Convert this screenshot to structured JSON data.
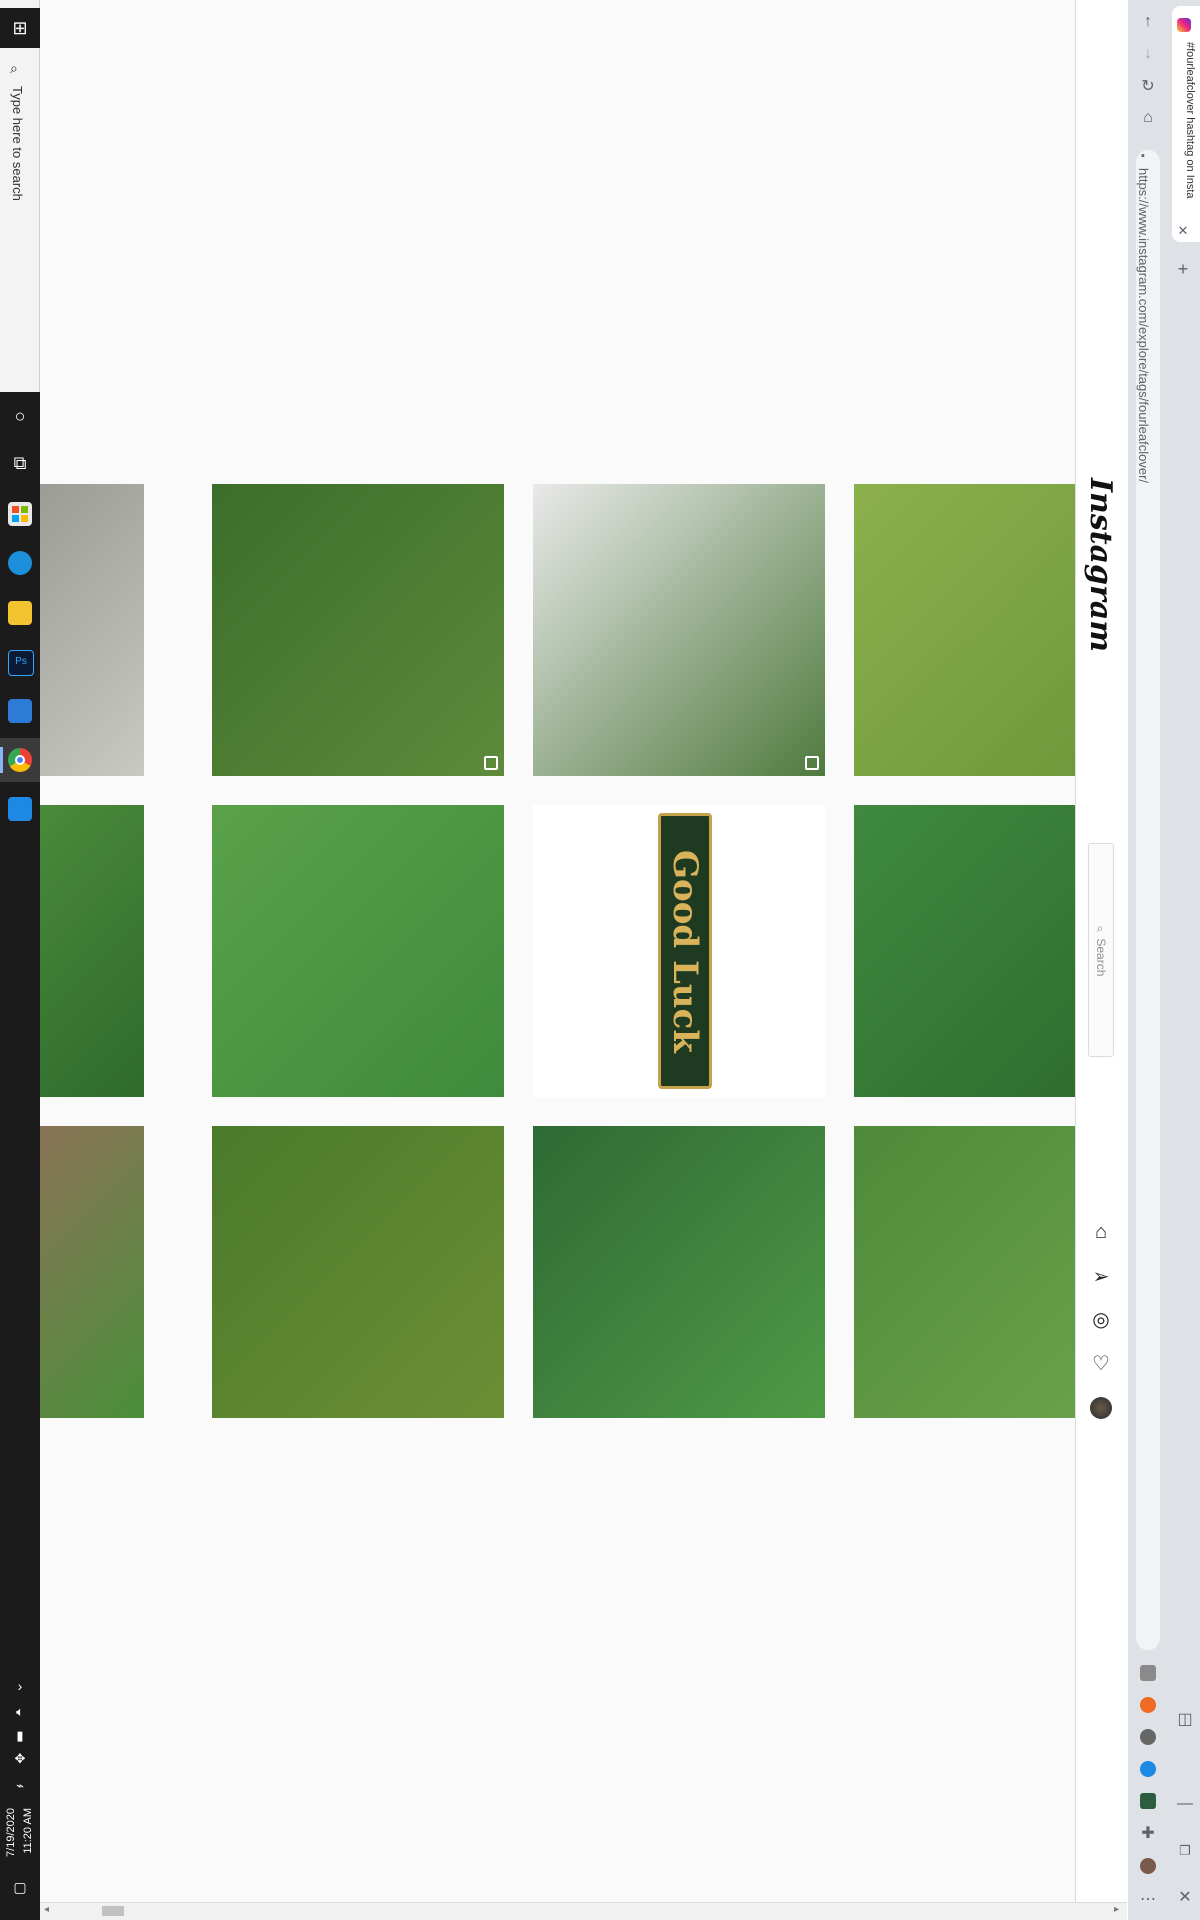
{
  "taskbar": {
    "search_placeholder": "Type here to search",
    "time": "11:20 AM",
    "date": "7/19/2020"
  },
  "browser": {
    "tab_title": "#fourleafclover hashtag on Insta",
    "url": "https://www.instagram.com/explore/tags/fourleafclover/"
  },
  "instagram": {
    "logo": "Instagram",
    "search_placeholder": "Search"
  },
  "grid": {
    "tiles": [
      {
        "name": "post-wood-fence",
        "colors": [
          "#9c9c97",
          "#c9c8c2"
        ]
      },
      {
        "name": "post-clover-dog",
        "colors": [
          "#3c6e2a",
          "#5e8a3b"
        ],
        "multi": true
      },
      {
        "name": "post-clover-mask-selfie",
        "colors": [
          "#e9e9e9",
          "#4f7a3e"
        ],
        "multi": true
      },
      {
        "name": "post-clover-hand-lawn",
        "colors": [
          "#8bb04c",
          "#6f9a3b"
        ]
      },
      {
        "name": "post-clover-patch",
        "colors": [
          "#4a8a3a",
          "#2e6b2c"
        ]
      },
      {
        "name": "post-four-leaf-closeup",
        "colors": [
          "#5aa14a",
          "#3f8b3b"
        ]
      },
      {
        "name": "post-good-luck-banner",
        "colors": [
          "#ffffff",
          "#ffffff"
        ]
      },
      {
        "name": "post-clover-grass",
        "colors": [
          "#3f8a3f",
          "#2e6e2f"
        ]
      },
      {
        "name": "post-boot",
        "colors": [
          "#8a7356",
          "#4a8f3a"
        ]
      },
      {
        "name": "post-fairy-figurine",
        "colors": [
          "#4a7a2b",
          "#6c8f35"
        ]
      },
      {
        "name": "post-clover-fingers",
        "colors": [
          "#2e6a35",
          "#4f9a45"
        ]
      },
      {
        "name": "post-clover-meadow",
        "colors": [
          "#4e8a3a",
          "#6aa04a"
        ]
      }
    ],
    "banner_text": "Good Luck"
  }
}
